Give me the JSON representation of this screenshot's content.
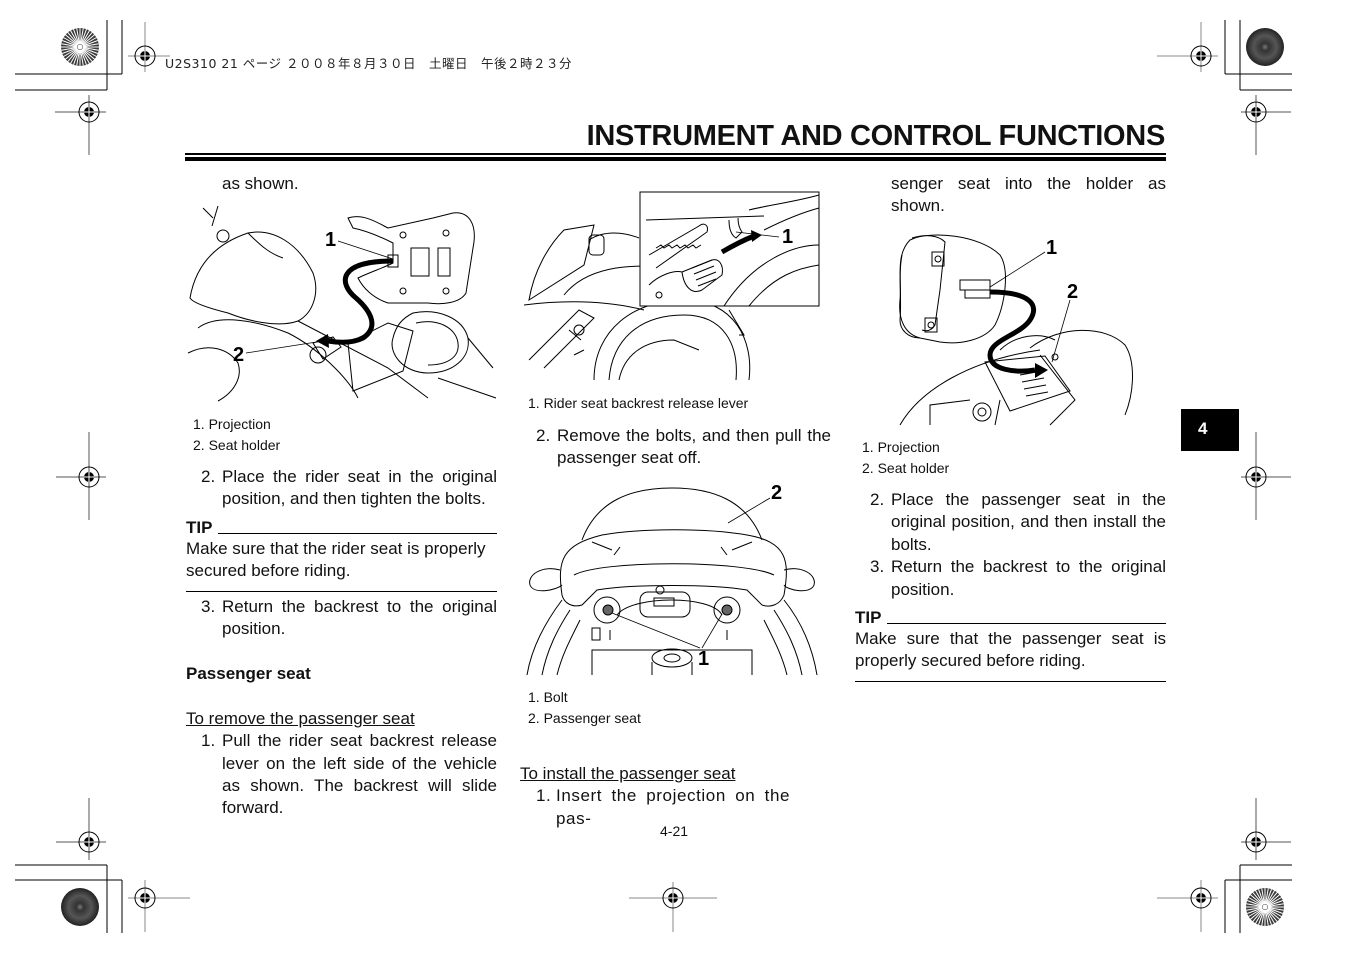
{
  "header": {
    "slug": "U2S310 21 ページ ２００８年８月３０日　土曜日　午後２時２３分",
    "title": "INSTRUMENT AND CONTROL FUNCTIONS"
  },
  "section_tab": "4",
  "column1": {
    "intro": "as shown.",
    "figure": {
      "callouts": [
        "1",
        "2"
      ],
      "captions": [
        "1. Projection",
        "2. Seat holder"
      ]
    },
    "step2": {
      "num": "2.",
      "text": "Place the rider seat in the original position, and then tighten the bolts."
    },
    "tip": {
      "label": "TIP",
      "text": "Make sure that the rider seat is properly secured before riding."
    },
    "step3": {
      "num": "3.",
      "text": "Return the backrest to the original position."
    },
    "heading": "Passenger seat",
    "subheading": "To remove the passenger seat",
    "step1": {
      "num": "1.",
      "text": "Pull the rider seat backrest release lever on the left side of the vehicle as shown. The backrest will slide forward."
    }
  },
  "column2": {
    "figure1": {
      "callouts": [
        "1"
      ],
      "captions": [
        "1. Rider seat backrest release lever"
      ]
    },
    "step2": {
      "num": "2.",
      "text": "Remove the bolts, and then pull the passenger seat off."
    },
    "figure2": {
      "callouts": [
        "2",
        "1"
      ],
      "captions": [
        "1. Bolt",
        "2. Passenger seat"
      ]
    },
    "subheading": "To install the passenger seat",
    "step1": {
      "num": "1.",
      "text": "Insert the projection on the pas-"
    }
  },
  "column3": {
    "continued": "senger seat into the holder as shown.",
    "figure": {
      "callouts": [
        "1",
        "2"
      ],
      "captions": [
        "1. Projection",
        "2. Seat holder"
      ]
    },
    "step2": {
      "num": "2.",
      "text": "Place the passenger seat in the original position, and then install the bolts."
    },
    "step3": {
      "num": "3.",
      "text": "Return the backrest to the original position."
    },
    "tip": {
      "label": "TIP",
      "text": "Make sure that the passenger seat is properly secured before riding."
    }
  },
  "footer": {
    "page_number": "4-21"
  }
}
